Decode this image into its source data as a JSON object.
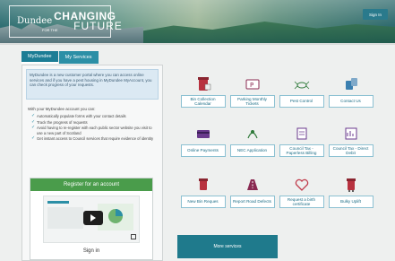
{
  "header": {
    "logo_word": "Dundee",
    "logo_line1": "CHANGING",
    "logo_line2": "FUTURE",
    "logo_tag": "FOR THE",
    "signin_label": "Sign In"
  },
  "tabs": [
    {
      "label": "MyDundee",
      "active": true
    },
    {
      "label": "My Services",
      "active": false
    }
  ],
  "intro_text": "MyDundee is a new customer portal where you can access online services and if you have a pest housing in MyDundee MyAccount, you can check progress of your requests.",
  "with_text": "With your MyDundee account you can:",
  "features": [
    "Automatically populate forms with your contact details",
    "Track the progress of requests",
    "Avoid having to re-register with each public sector website you visit to use a new part of Scotland",
    "Get instant access to Council services that require evidence of identity"
  ],
  "register_label": "Register for an account",
  "sign_in_label": "Sign in",
  "services": [
    {
      "label": "Bin Collection Calendar",
      "icon": "bin-calendar-icon"
    },
    {
      "label": "Parking Monthly Tickets",
      "icon": "parking-ticket-icon"
    },
    {
      "label": "Pest Control",
      "icon": "pest-control-icon"
    },
    {
      "label": "Contact Us",
      "icon": "contact-us-icon"
    },
    {
      "label": "Online Payments",
      "icon": "online-payments-icon"
    },
    {
      "label": "NEC Application",
      "icon": "nec-application-icon"
    },
    {
      "label": "Council Tax - Paperless Billing",
      "icon": "council-tax-paperless-icon"
    },
    {
      "label": "Council Tax - Direct Debit",
      "icon": "council-tax-debit-icon"
    },
    {
      "label": "New Bin Reques",
      "icon": "new-bin-icon"
    },
    {
      "label": "Report Road Defects",
      "icon": "road-defects-icon"
    },
    {
      "label": "Request a birth certificate",
      "icon": "birth-certificate-icon"
    },
    {
      "label": "Bulky Uplift",
      "icon": "bulky-uplift-icon"
    }
  ],
  "more_services_label": "More services",
  "colors": {
    "accent": "#2b8fa6",
    "register_green": "#4a9c4b",
    "more_services": "#1f7a8c"
  }
}
